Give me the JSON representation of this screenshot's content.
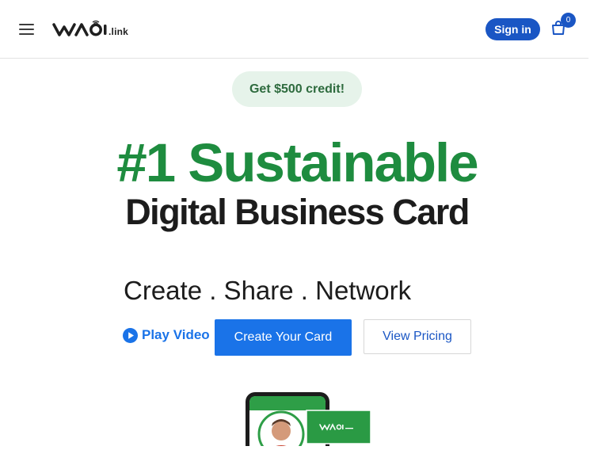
{
  "header": {
    "logo_text": "link",
    "signin_label": "Sign in",
    "cart_count": "0"
  },
  "promo": {
    "credit_label": "Get $500 credit!"
  },
  "hero": {
    "headline": "#1 Sustainable",
    "subheadline": "Digital Business Card",
    "tagline": "Create . Share . Network"
  },
  "actions": {
    "play_video_label": "Play Video",
    "create_card_label": "Create Your Card",
    "view_pricing_label": "View Pricing"
  },
  "colors": {
    "brand_green": "#1e8c3f",
    "brand_blue": "#1a73e8",
    "signin_blue": "#1a56c4"
  },
  "icons": {
    "menu": "hamburger-menu-icon",
    "cart": "shopping-bag-icon",
    "play": "play-circle-icon"
  }
}
